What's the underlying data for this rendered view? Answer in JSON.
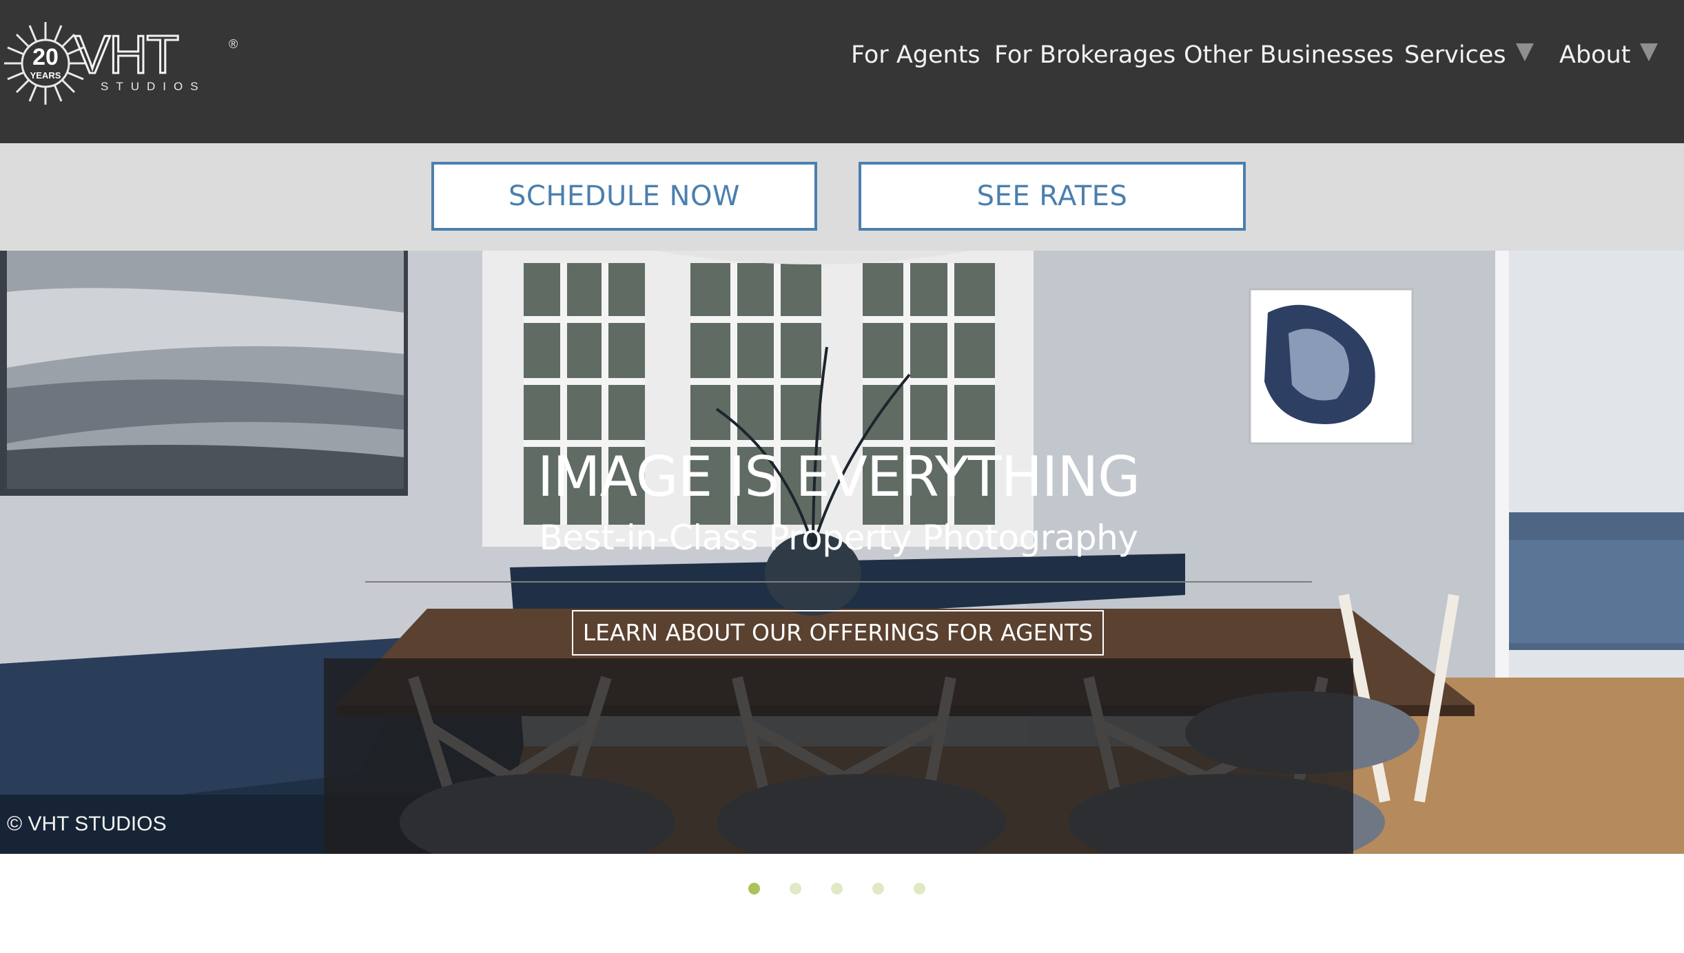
{
  "header": {
    "logo": {
      "badge_number": "20",
      "badge_text": "YEARS",
      "brand": "VHT",
      "sub_brand": "STUDIOS",
      "registered": "®"
    },
    "nav": [
      {
        "label": "For Agents",
        "has_dropdown": false
      },
      {
        "label": "For Brokerages",
        "has_dropdown": false
      },
      {
        "label": "Other Businesses",
        "has_dropdown": false
      },
      {
        "label": "Services",
        "has_dropdown": true
      },
      {
        "label": "About",
        "has_dropdown": true
      }
    ]
  },
  "cta": {
    "schedule_label": "SCHEDULE NOW",
    "rates_label": "SEE RATES"
  },
  "hero": {
    "headline": "IMAGE IS EVERYTHING",
    "subhead": "Best-in-Class Property Photography",
    "button_label": "LEARN ABOUT OUR OFFERINGS FOR AGENTS",
    "credit": "© VHT STUDIOS"
  },
  "carousel": {
    "slide_count": 5,
    "active_index": 0
  },
  "colors": {
    "header_bg": "#363636",
    "cta_band_bg": "#dcdcdc",
    "cta_accent": "#4b7fae",
    "dot_active": "#a9c25a",
    "dot_inactive": "#dfe9c4"
  },
  "icons": [
    "dropdown-caret-icon"
  ]
}
